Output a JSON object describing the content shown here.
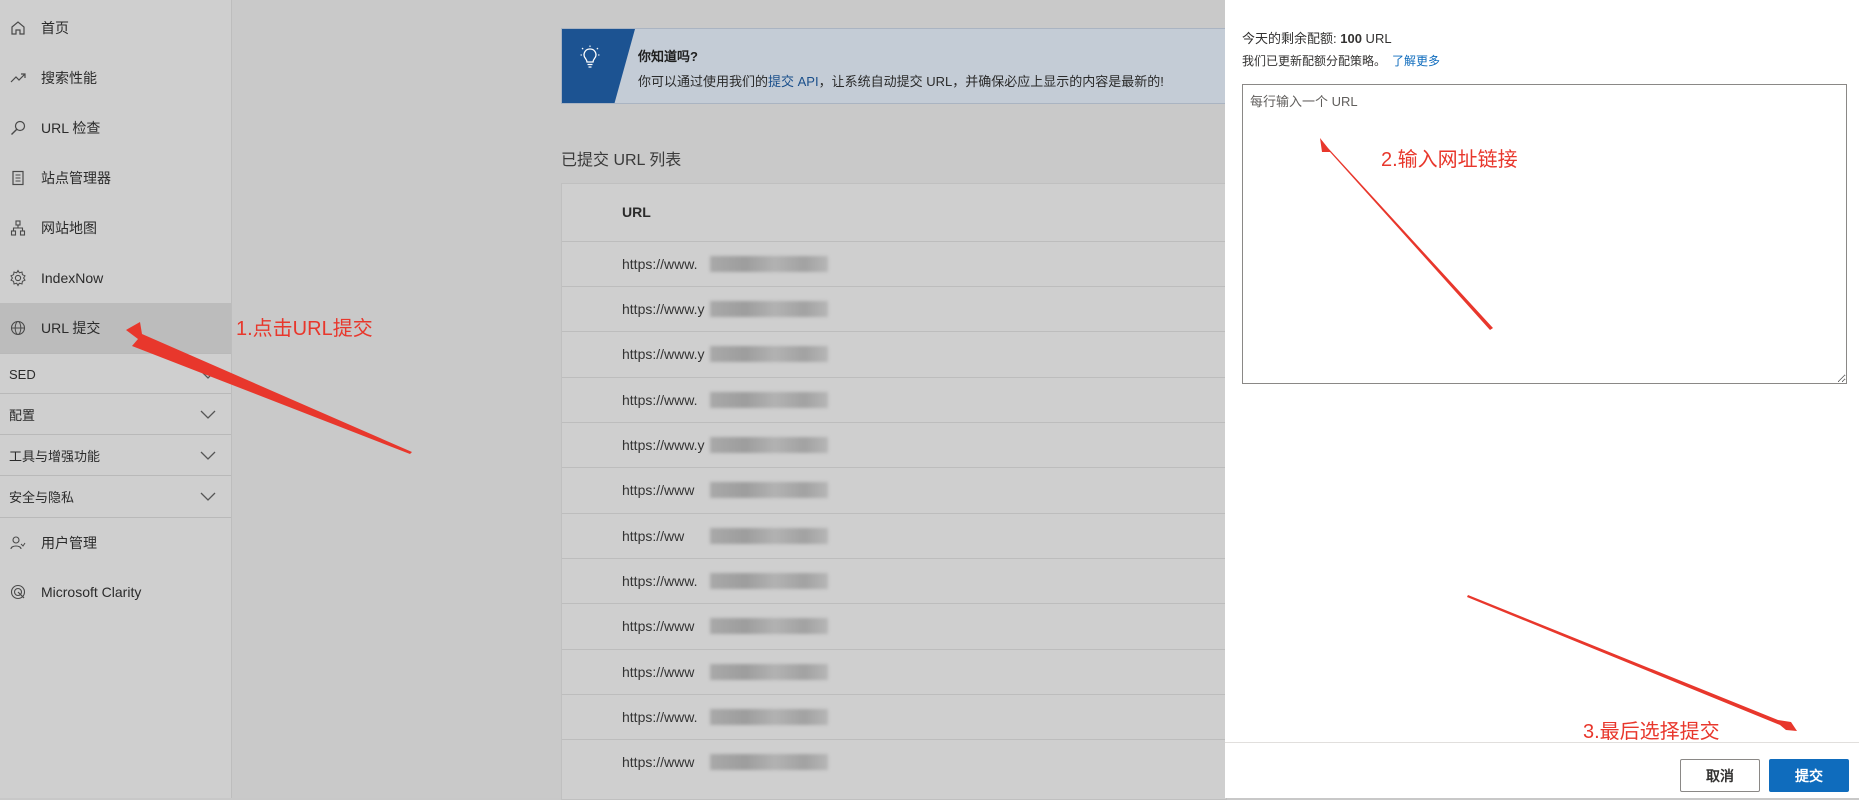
{
  "sidebar": {
    "items": [
      {
        "label": "首页",
        "icon": "home-icon"
      },
      {
        "label": "搜索性能",
        "icon": "trend-icon"
      },
      {
        "label": "URL 检查",
        "icon": "search-icon"
      },
      {
        "label": "站点管理器",
        "icon": "document-icon"
      },
      {
        "label": "网站地图",
        "icon": "sitemap-icon"
      },
      {
        "label": "IndexNow",
        "icon": "gear-icon"
      },
      {
        "label": "URL 提交",
        "icon": "globe-icon"
      }
    ],
    "groups": [
      {
        "label": "SED"
      },
      {
        "label": "配置"
      },
      {
        "label": "工具与增强功能"
      },
      {
        "label": "安全与隐私"
      }
    ],
    "bottom_items": [
      {
        "label": "用户管理",
        "icon": "user-icon"
      },
      {
        "label": "Microsoft Clarity",
        "icon": "clarity-icon"
      }
    ]
  },
  "banner": {
    "title": "你知道吗?",
    "text_before": "你可以通过使用我们的",
    "link": "提交 API",
    "text_after": "，让系统自动提交 URL，并确保必应上显示的内容是最新的!"
  },
  "list": {
    "title": "已提交 URL 列表",
    "column": "URL",
    "rows": [
      "https://www.",
      "https://www.y",
      "https://www.y",
      "https://www.",
      "https://www.y",
      "https://www",
      "https://ww",
      "https://www.",
      "https://www",
      "https://www",
      "https://www.",
      "https://www"
    ]
  },
  "panel": {
    "quota_label": "今天的剩余配额: ",
    "quota_value": "100",
    "quota_unit": " URL",
    "policy_text": "我们已更新配额分配策略。",
    "learn_more": "了解更多",
    "textarea_placeholder": "每行输入一个 URL",
    "cancel": "取消",
    "submit": "提交"
  },
  "annotations": {
    "step1": "1.点击URL提交",
    "step2": "2.输入网址链接",
    "step3": "3.最后选择提交",
    "color": "#e8372c"
  }
}
